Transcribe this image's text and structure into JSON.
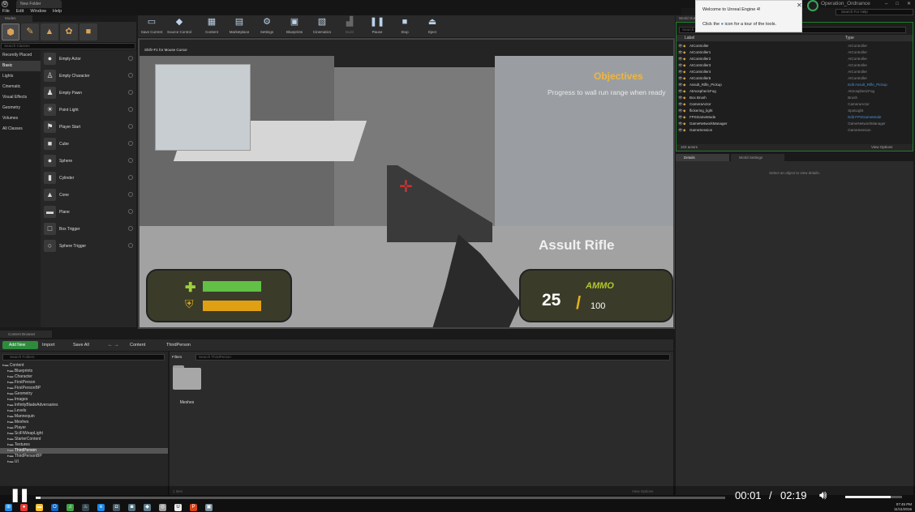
{
  "window": {
    "doc_tab": "New Folder",
    "project_name": "Operation_Ordnance",
    "search_help_placeholder": "Search For Help",
    "controls": [
      "–",
      "□",
      "✕"
    ]
  },
  "menubar": [
    "File",
    "Edit",
    "Window",
    "Help"
  ],
  "modes": {
    "tab": "Modes",
    "search_placeholder": "Search Classes",
    "categories": [
      "Recently Placed",
      "Basic",
      "Lights",
      "Cinematic",
      "Visual Effects",
      "Geometry",
      "Volumes",
      "All Classes"
    ],
    "active_category": "Basic",
    "items": [
      "Empty Actor",
      "Empty Character",
      "Empty Pawn",
      "Point Light",
      "Player Start",
      "Cube",
      "Sphere",
      "Cylinder",
      "Cone",
      "Plane",
      "Box Trigger",
      "Sphere Trigger"
    ]
  },
  "toolbar": {
    "buttons": [
      "Save Current",
      "Source Control",
      "Content",
      "Marketplace",
      "Settings",
      "Blueprints",
      "Cinematics",
      "Build",
      "Pause",
      "Stop",
      "Eject"
    ]
  },
  "viewport": {
    "hint": "Shift+F1 for Mouse Cursor",
    "objectives_title": "Objectives",
    "objectives_text": "Progress to wall run range when ready",
    "weapon_name": "Assult Rifle",
    "ammo_label": "AMMO",
    "ammo_current": "25",
    "ammo_slash": "/",
    "ammo_max": "100",
    "health_level": 1.0,
    "shield_level": 1.0,
    "colors": {
      "health": "#62c046",
      "shield": "#e0a014",
      "objectives": "#f0b63c"
    }
  },
  "outliner": {
    "tab": "World Outliner",
    "search_placeholder": "Search...",
    "col_label": "Label",
    "col_type": "Type",
    "rows": [
      {
        "label": "AIController",
        "type": "AIController"
      },
      {
        "label": "AIController1",
        "type": "AIController"
      },
      {
        "label": "AIController2",
        "type": "AIController"
      },
      {
        "label": "AIController3",
        "type": "AIController"
      },
      {
        "label": "AIController4",
        "type": "AIController"
      },
      {
        "label": "AIController5",
        "type": "AIController"
      },
      {
        "label": "Assult_Rifle_Pickup",
        "type": "Edit Assult_Rifle_Pickup"
      },
      {
        "label": "AtmosphericFog",
        "type": "AtmosphericFog"
      },
      {
        "label": "Box Brush",
        "type": "Brush"
      },
      {
        "label": "CameraActor",
        "type": "CameraActor"
      },
      {
        "label": "flickering_light",
        "type": "SpotLight"
      },
      {
        "label": "FPSGameMode",
        "type": "Edit FPSGameMode"
      },
      {
        "label": "GameNetworkManager",
        "type": "GameNetworkManager"
      },
      {
        "label": "GameSession",
        "type": "GameSession"
      }
    ],
    "actor_count": "103 actors",
    "view_options": "View Options"
  },
  "welcome": {
    "title": "Welcome to Unreal Engine 4!",
    "text_before": "Click the",
    "text_after": "icon for a tour of the tools."
  },
  "details": {
    "tabs": [
      "Details",
      "World Settings"
    ],
    "message": "Select an object to view details."
  },
  "content_browser": {
    "tab": "Content Browser",
    "add_new": "Add New",
    "import": "Import",
    "save_all": "Save All",
    "breadcrumb": [
      "Content",
      "ThirdPerson"
    ],
    "folder_search_placeholder": "Search Folders",
    "filters": "Filters",
    "asset_search_placeholder": "Search ThirdPerson",
    "tree": [
      {
        "name": "Content",
        "level": 0
      },
      {
        "name": "Blueprints",
        "level": 1
      },
      {
        "name": "Character",
        "level": 1
      },
      {
        "name": "FirstPerson",
        "level": 1
      },
      {
        "name": "FirstPersonBP",
        "level": 1
      },
      {
        "name": "Geometry",
        "level": 1
      },
      {
        "name": "Images",
        "level": 1
      },
      {
        "name": "InfinityBladeAdversaries",
        "level": 1
      },
      {
        "name": "Levels",
        "level": 1
      },
      {
        "name": "Mannequin",
        "level": 1
      },
      {
        "name": "Meshes",
        "level": 1
      },
      {
        "name": "Player",
        "level": 1
      },
      {
        "name": "SciFiWeapLight",
        "level": 1
      },
      {
        "name": "StarterContent",
        "level": 1
      },
      {
        "name": "Textures",
        "level": 1
      },
      {
        "name": "ThirdPerson",
        "level": 1
      },
      {
        "name": "ThirdPersonBP",
        "level": 1
      },
      {
        "name": "UI",
        "level": 1
      }
    ],
    "selected_folder": "ThirdPerson",
    "asset_folder": "Meshes",
    "item_count": "1 item",
    "view_options": "View Options"
  },
  "video": {
    "time_current": "00:01",
    "time_separator": "/",
    "time_total": "02:19",
    "progress": 0.007,
    "volume": 0.8
  },
  "taskbar": {
    "icons": [
      "windows-icon",
      "chrome-icon",
      "explorer-icon",
      "outlook-icon",
      "spotify-icon",
      "steam-icon",
      "edge-icon",
      "app-icon",
      "app2-icon",
      "app3-icon",
      "unity-icon",
      "unreal-icon",
      "powerpoint-icon",
      "app4-icon"
    ],
    "time": "07:45 PM",
    "date": "11/11/2016"
  }
}
